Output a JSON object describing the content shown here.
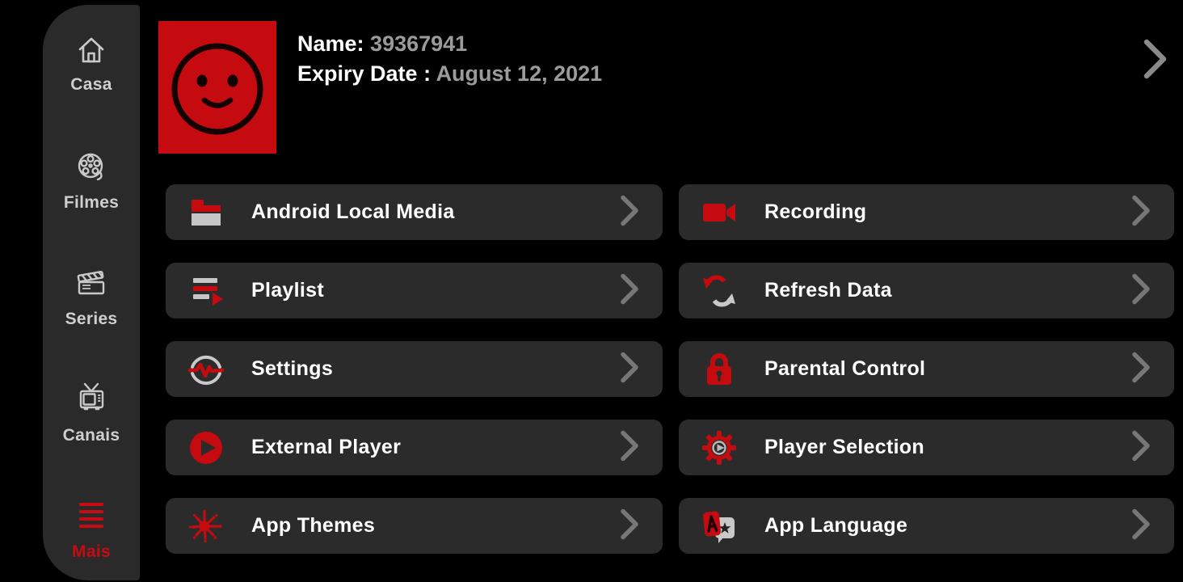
{
  "sidebar": {
    "items": [
      {
        "label": "Casa",
        "icon": "home-icon"
      },
      {
        "label": "Filmes",
        "icon": "film-reel-icon"
      },
      {
        "label": "Series",
        "icon": "clapperboard-icon"
      },
      {
        "label": "Canais",
        "icon": "tv-icon"
      },
      {
        "label": "Mais",
        "icon": "menu-icon",
        "active": true
      }
    ]
  },
  "header": {
    "name_label": "Name:",
    "name_value": "39367941",
    "expiry_label": "Expiry Date :",
    "expiry_value": "August 12, 2021",
    "avatar": "smiley-face"
  },
  "menu_tiles": [
    {
      "label": "Android Local Media",
      "icon": "folder-icon"
    },
    {
      "label": "Recording",
      "icon": "video-camera-icon"
    },
    {
      "label": "Playlist",
      "icon": "playlist-icon"
    },
    {
      "label": "Refresh Data",
      "icon": "refresh-icon"
    },
    {
      "label": "Settings",
      "icon": "pulse-gauge-icon"
    },
    {
      "label": "Parental Control",
      "icon": "lock-icon"
    },
    {
      "label": "External Player",
      "icon": "play-circle-icon"
    },
    {
      "label": "Player Selection",
      "icon": "gear-play-icon"
    },
    {
      "label": "App Themes",
      "icon": "paint-splash-icon"
    },
    {
      "label": "App Language",
      "icon": "translate-icon"
    }
  ],
  "colors": {
    "background": "#000000",
    "surface": "#2b2b2b",
    "sidebar": "#2a2a2a",
    "accent_red": "#c60b10",
    "text_primary": "#ffffff",
    "text_secondary": "#9b9b9b",
    "icon_gray": "#c9c9c9",
    "chevron_gray": "#777777"
  }
}
